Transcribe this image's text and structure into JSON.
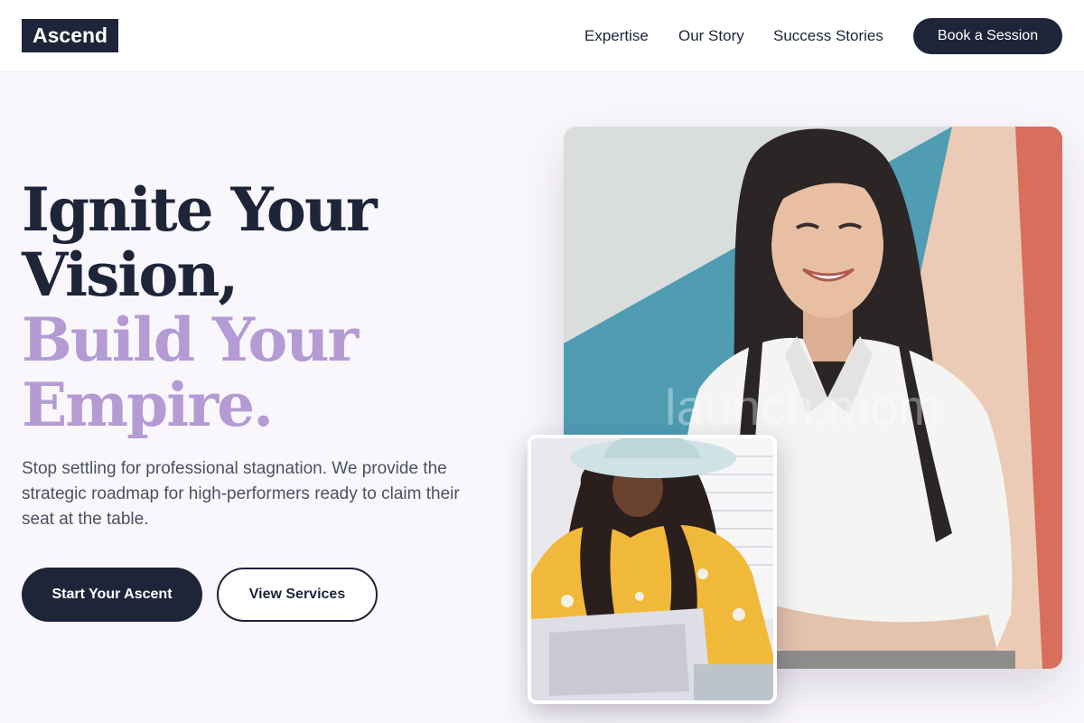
{
  "brand": {
    "logo": "Ascend"
  },
  "nav": {
    "links": [
      "Expertise",
      "Our Story",
      "Success Stories"
    ],
    "cta": "Book a Session"
  },
  "hero": {
    "headline_line1": "Ignite Your",
    "headline_line2": "Vision,",
    "headline_line3": "Build Your",
    "headline_line4": "Empire.",
    "description": "Stop settling for professional stagnation. We provide the strategic roadmap for high-performers ready to claim their seat at the table.",
    "primary_button": "Start Your Ascent",
    "secondary_button": "View Services"
  },
  "images": {
    "main_watermark": "launch.mom"
  },
  "colors": {
    "navy": "#1e2538",
    "lavender": "#b49bd4",
    "background": "#faf7fc"
  }
}
